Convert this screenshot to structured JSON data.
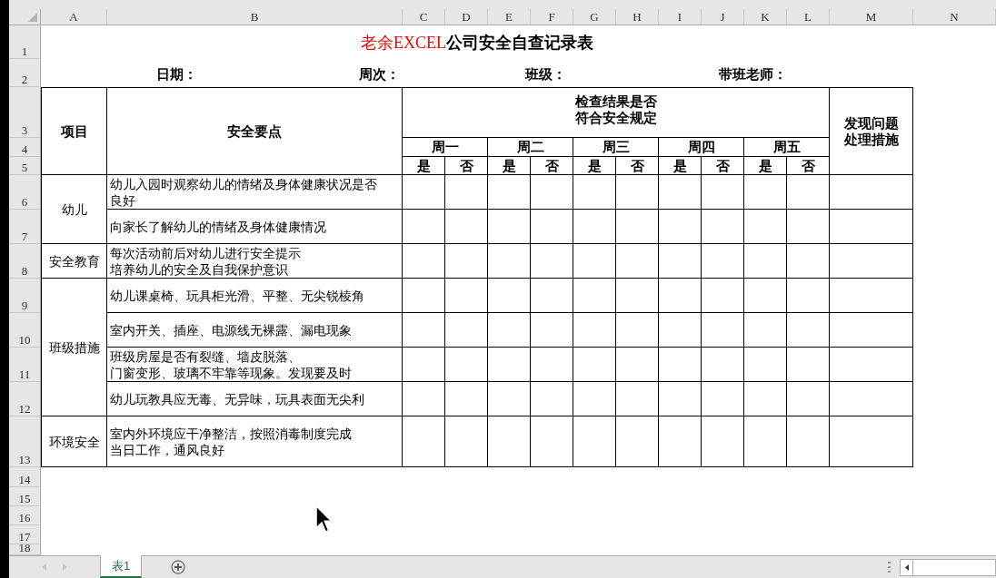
{
  "column_headers": [
    "A",
    "B",
    "C",
    "D",
    "E",
    "F",
    "G",
    "H",
    "I",
    "J",
    "K",
    "L",
    "M",
    "N"
  ],
  "row_headers": [
    "1",
    "2",
    "3",
    "4",
    "5",
    "6",
    "7",
    "8",
    "9",
    "10",
    "11",
    "12",
    "13",
    "14",
    "15",
    "16",
    "17",
    "18"
  ],
  "title": {
    "brand": "老余EXCEL",
    "text": "公司安全自查记录表"
  },
  "info_labels": [
    "日期：",
    "周次：",
    "班级：",
    "带班老师："
  ],
  "table": {
    "item_header": "项目",
    "point_header": "安全要点",
    "check_header": [
      "检查结果是否",
      "符合安全规定"
    ],
    "action_header": [
      "发现问题",
      "处理措施"
    ],
    "days": [
      {
        "label": "周一",
        "yes": "是",
        "no": "否"
      },
      {
        "label": "周二",
        "yes": "是",
        "no": "否"
      },
      {
        "label": "周三",
        "yes": "是",
        "no": "否"
      },
      {
        "label": "周四",
        "yes": "是",
        "no": "否"
      },
      {
        "label": "周五",
        "yes": "是",
        "no": "否"
      }
    ],
    "sections": [
      {
        "category": "幼儿",
        "items": [
          [
            "幼儿入园时观察幼儿的情绪及身体健康状况是否",
            "良好"
          ],
          [
            "向家长了解幼儿的情绪及身体健康情况"
          ]
        ]
      },
      {
        "category": "安全教育",
        "items": [
          [
            "每次活动前后对幼儿进行安全提示",
            "培养幼儿的安全及自我保护意识"
          ]
        ]
      },
      {
        "category": "班级措施",
        "items": [
          [
            "幼儿课桌椅、玩具柜光滑、平整、无尖锐棱角"
          ],
          [
            "室内开关、插座、电源线无裸露、漏电现象"
          ],
          [
            "班级房屋是否有裂缝、墙皮脱落、",
            "门窗变形、玻璃不牢靠等现象。发现要及时"
          ],
          [
            "幼儿玩教具应无毒、无异味，玩具表面无尖利"
          ]
        ]
      },
      {
        "category": "环境安全",
        "items": [
          [
            "室内外环境应干净整洁，按照消毒制度完成",
            "当日工作，通风良好"
          ]
        ]
      }
    ]
  },
  "sheet_tabs": [
    {
      "label": "表1",
      "selected": true
    }
  ]
}
